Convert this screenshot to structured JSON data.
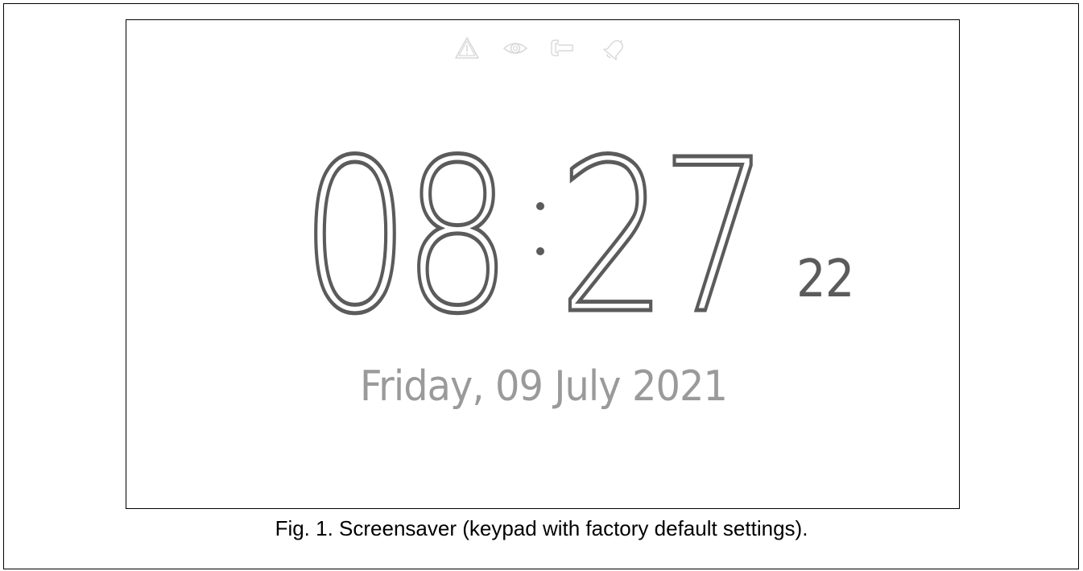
{
  "screensaver": {
    "status_icons": [
      {
        "name": "alarm-warning-icon",
        "color": "#d8d8d8"
      },
      {
        "name": "eye-icon",
        "color": "#d8d8d8"
      },
      {
        "name": "service-key-icon",
        "color": "#d8d8d8"
      },
      {
        "name": "bell-icon",
        "color": "#d8d8d8"
      }
    ],
    "clock": {
      "hours": "08",
      "minutes": "27",
      "seconds": "22"
    },
    "date": "Friday, 09 July 2021"
  },
  "caption": "Fig. 1. Screensaver (keypad with factory default settings).",
  "colors": {
    "clock_digits": "#5b5b5b",
    "date_text": "#9a9a9a",
    "status_icons": "#d8d8d8"
  }
}
